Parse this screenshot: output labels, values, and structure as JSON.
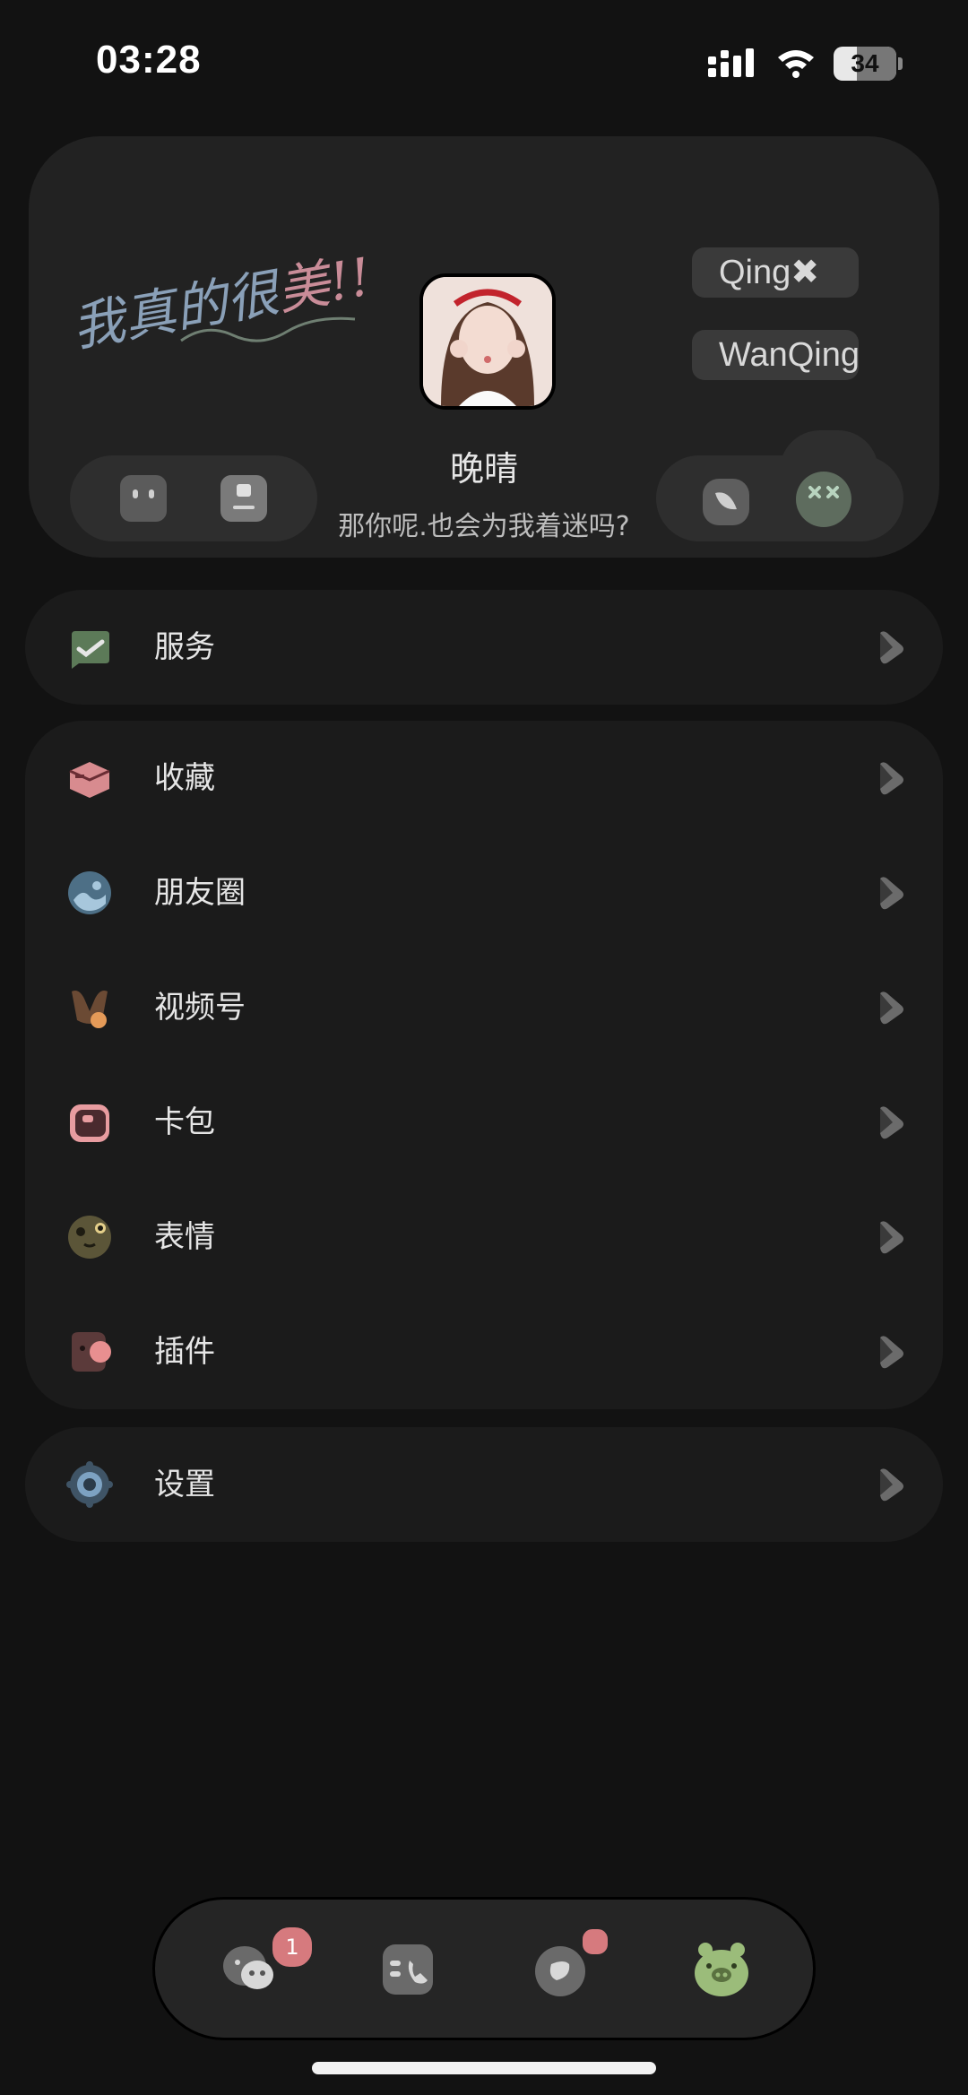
{
  "status_bar": {
    "time": "03:28",
    "battery": "34"
  },
  "profile": {
    "script_text_main": "我真的很",
    "script_text_accent": "美!!",
    "name": "晚晴",
    "signature": "那你呢.也会为我着迷吗?",
    "tag_1": "Qing✖",
    "tag_2": "WanQing"
  },
  "menu_groups": [
    {
      "items": [
        {
          "label": "服务",
          "icon": "check-chat-icon"
        }
      ]
    },
    {
      "items": [
        {
          "label": "收藏",
          "icon": "box-icon"
        },
        {
          "label": "朋友圈",
          "icon": "moments-icon"
        },
        {
          "label": "视频号",
          "icon": "channels-icon"
        },
        {
          "label": "卡包",
          "icon": "wallet-icon"
        },
        {
          "label": "表情",
          "icon": "emoji-face-icon"
        },
        {
          "label": "插件",
          "icon": "plugin-icon"
        }
      ]
    },
    {
      "items": [
        {
          "label": "设置",
          "icon": "settings-gear-icon"
        }
      ]
    }
  ],
  "tabbar": {
    "chats_badge": "1",
    "tabs": [
      "chats-icon",
      "contacts-icon",
      "discover-icon",
      "me-pig-icon"
    ]
  },
  "colors": {
    "background": "#121212",
    "card": "#1b1b1b",
    "accent_pink": "#d67a7e",
    "accent_green": "#9bbc7a"
  }
}
